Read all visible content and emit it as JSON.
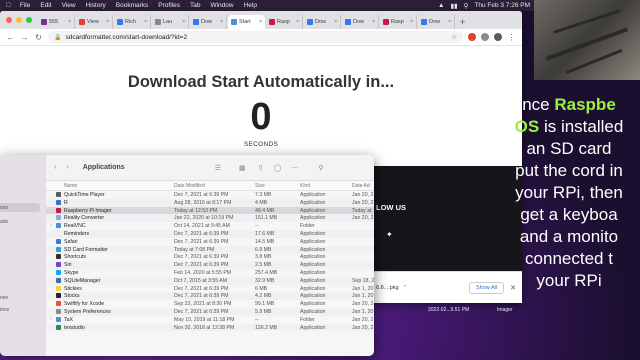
{
  "menubar": {
    "items": [
      "File",
      "Edit",
      "View",
      "History",
      "Bookmarks",
      "Profiles",
      "Tab",
      "Window",
      "Help"
    ],
    "clock": "Thu Feb 3  7:26 PM"
  },
  "browser": {
    "tabs": [
      "555",
      "View",
      "Rich",
      "Lau",
      "Dow",
      "Start",
      "Rasp",
      "Dow",
      "Dow",
      "Rasp",
      "Dow"
    ],
    "url": "sdcardformatter.com/start-download/?id=2",
    "headline": "Download Start Automatically in...",
    "countdown": "0",
    "seconds_label": "SECONDS",
    "follow_text": "LOW US",
    "download_file": "6.8....pkg",
    "show_all": "Show All"
  },
  "desktop_labels": [
    "2022-02...9.51 PM",
    "Imager"
  ],
  "finder": {
    "title": "Applications",
    "sidebar": [
      "ons",
      "ads",
      "rive",
      "ions"
    ],
    "columns": [
      "Name",
      "Date Modified",
      "Size",
      "Kind",
      "Date Ad"
    ],
    "rows": [
      {
        "name": "QuickTime Player",
        "date": "Dec 7, 2021 at 6:39 PM",
        "size": "7.3 MB",
        "kind": "Application",
        "added": "Jan 20, 2"
      },
      {
        "name": "R",
        "date": "Aug 28, 2016 at 8:17 PM",
        "size": "4 MB",
        "kind": "Application",
        "added": "Jan 20, 2"
      },
      {
        "name": "Raspberry Pi Imager",
        "date": "Today at 12:53 PM",
        "size": "48.4 MB",
        "kind": "Application",
        "added": "Today at"
      },
      {
        "name": "Reality Converter",
        "date": "Jan 22, 2020 at 10:19 PM",
        "size": "151.1 MB",
        "kind": "Application",
        "added": "Jan 20, 2"
      },
      {
        "name": "RealVNC",
        "date": "Oct 14, 2021 at 9:45 AM",
        "size": "--",
        "kind": "Folder",
        "added": ""
      },
      {
        "name": "Reminders",
        "date": "Dec 7, 2021 at 6:39 PM",
        "size": "17.6 MB",
        "kind": "Application",
        "added": ""
      },
      {
        "name": "Safari",
        "date": "Dec 7, 2021 at 6:39 PM",
        "size": "14.5 MB",
        "kind": "Application",
        "added": ""
      },
      {
        "name": "SD Card Formatter",
        "date": "Today at 7:08 PM",
        "size": "6.9 MB",
        "kind": "Application",
        "added": ""
      },
      {
        "name": "Shortcuts",
        "date": "Dec 7, 2021 at 6:39 PM",
        "size": "3.8 MB",
        "kind": "Application",
        "added": ""
      },
      {
        "name": "Siri",
        "date": "Dec 7, 2021 at 6:39 PM",
        "size": "2.5 MB",
        "kind": "Application",
        "added": ""
      },
      {
        "name": "Skype",
        "date": "Feb 14, 2020 at 5:55 PM",
        "size": "257.4 MB",
        "kind": "Application",
        "added": ""
      },
      {
        "name": "SQLiteManager",
        "date": "Oct 7, 2015 at 3:55 AM",
        "size": "32.9 MB",
        "kind": "Application",
        "added": "Sep 18, 2"
      },
      {
        "name": "Stickies",
        "date": "Dec 7, 2021 at 6:39 PM",
        "size": "6 MB",
        "kind": "Application",
        "added": "Jan 1, 20"
      },
      {
        "name": "Stocks",
        "date": "Dec 7, 2021 at 6:39 PM",
        "size": "4.2 MB",
        "kind": "Application",
        "added": "Jan 1, 20"
      },
      {
        "name": "Swiftify for Xcode",
        "date": "Sep 23, 2021 at 8:30 PM",
        "size": "99.1 MB",
        "kind": "Application",
        "added": "Jan 20, 2"
      },
      {
        "name": "System Preferences",
        "date": "Dec 7, 2021 at 6:39 PM",
        "size": "5.9 MB",
        "kind": "Application",
        "added": "Jan 1, 20"
      },
      {
        "name": "TaX",
        "date": "May 10, 2019 at 11:18 PM",
        "size": "--",
        "kind": "Folder",
        "added": "Jan 20, 2"
      },
      {
        "name": "texstudio",
        "date": "Nov 30, 2018 at 12:38 PM",
        "size": "126.2 MB",
        "kind": "Application",
        "added": "Jan 20, 2"
      }
    ]
  },
  "caption": {
    "line1_a": "nce ",
    "line1_b": "Raspbe",
    "line2_a": "OS",
    "line2_b": " is installed",
    "lines": [
      "an SD card",
      "put the cord in",
      "your RPi, then",
      "get a keyboa",
      "and a monito",
      "connected t",
      "your RPi"
    ]
  },
  "colors": {
    "caption_green": "#9cf03c",
    "finder_selection": "#d8d8dc",
    "chrome_tabbar": "#dfe1e5"
  }
}
